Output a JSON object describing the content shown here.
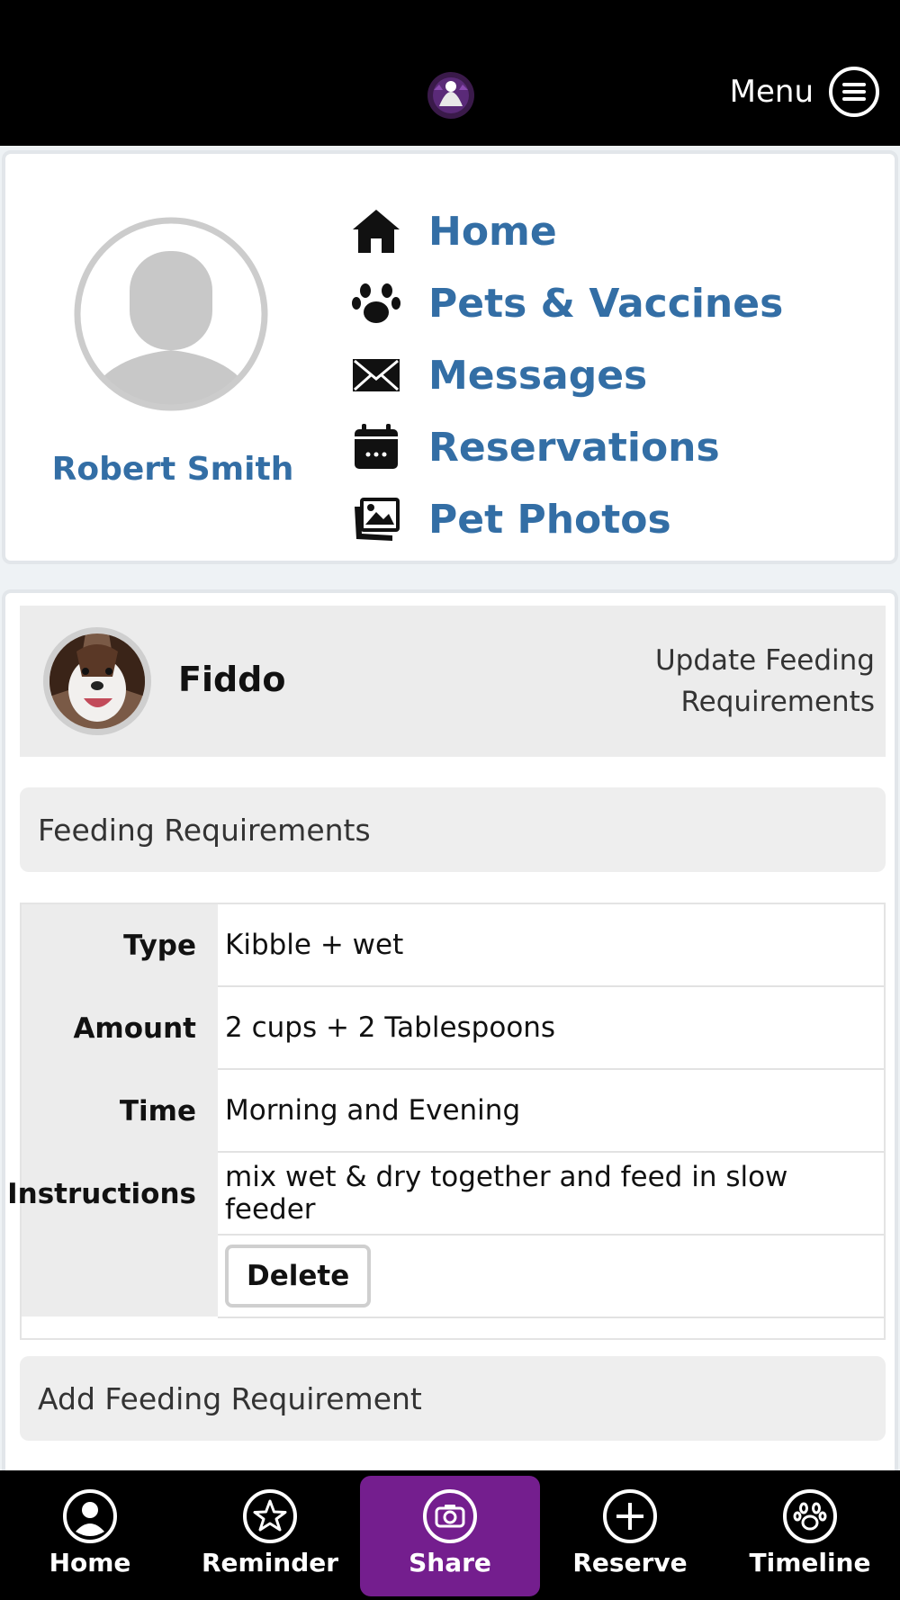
{
  "header": {
    "menu_label": "Menu"
  },
  "profile": {
    "name": "Robert Smith"
  },
  "nav": [
    {
      "label": "Home",
      "icon": "house-icon"
    },
    {
      "label": "Pets & Vaccines",
      "icon": "paw-icon"
    },
    {
      "label": "Messages",
      "icon": "envelope-icon"
    },
    {
      "label": "Reservations",
      "icon": "calendar-icon"
    },
    {
      "label": "Pet Photos",
      "icon": "photos-icon"
    }
  ],
  "pet": {
    "name": "Fiddo",
    "update_link": "Update Feeding Requirements"
  },
  "feeding": {
    "title": "Feeding Requirements",
    "rows": [
      {
        "label": "Type",
        "value": "Kibble + wet"
      },
      {
        "label": "Amount",
        "value": "2 cups + 2 Tablespoons"
      },
      {
        "label": "Time",
        "value": "Morning and Evening"
      },
      {
        "label": "Instructions",
        "value": "mix wet & dry together and feed in slow feeder"
      }
    ],
    "delete_label": "Delete",
    "add_label": "Add Feeding Requirement"
  },
  "tabs": [
    {
      "label": "Home",
      "icon": "user-circle-icon"
    },
    {
      "label": "Reminder",
      "icon": "star-circle-icon"
    },
    {
      "label": "Share",
      "icon": "camera-circle-icon",
      "active": true
    },
    {
      "label": "Reserve",
      "icon": "plus-circle-icon"
    },
    {
      "label": "Timeline",
      "icon": "paw-circle-icon"
    }
  ],
  "colors": {
    "link": "#336ea5",
    "accent": "#741e8e",
    "bar": "#000000"
  }
}
